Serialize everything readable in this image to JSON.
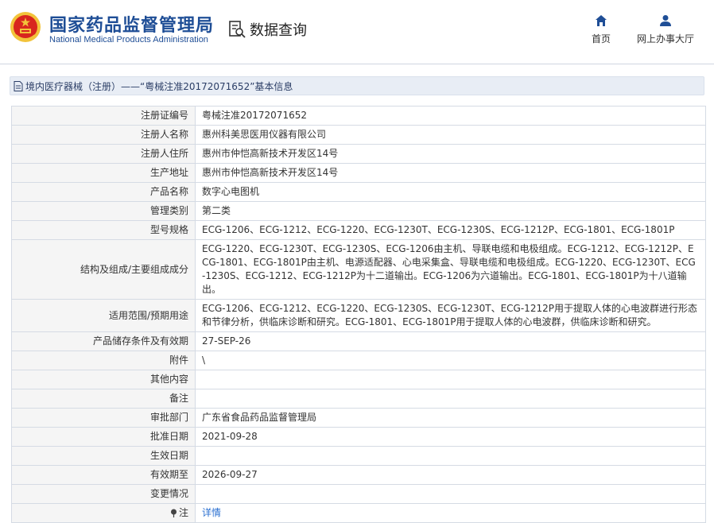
{
  "header": {
    "brand_cn": "国家药品监督管理局",
    "brand_en": "National Medical Products Administration",
    "query_label": "数据查询",
    "nav_home": "首页",
    "nav_hall": "网上办事大厅"
  },
  "breadcrumb": {
    "text": "境内医疗器械（注册）——“粤械注准20172071652”基本信息"
  },
  "rows": [
    {
      "label": "注册证编号",
      "value": "粤械注准20172071652"
    },
    {
      "label": "注册人名称",
      "value": "惠州科美思医用仪器有限公司"
    },
    {
      "label": "注册人住所",
      "value": "惠州市仲恺高新技术开发区14号"
    },
    {
      "label": "生产地址",
      "value": "惠州市仲恺高新技术开发区14号"
    },
    {
      "label": "产品名称",
      "value": "数字心电图机"
    },
    {
      "label": "管理类别",
      "value": "第二类"
    },
    {
      "label": "型号规格",
      "value": "ECG-1206、ECG-1212、ECG-1220、ECG-1230T、ECG-1230S、ECG-1212P、ECG-1801、ECG-1801P"
    },
    {
      "label": "结构及组成/主要组成成分",
      "value": "ECG-1220、ECG-1230T、ECG-1230S、ECG-1206由主机、导联电缆和电极组成。ECG-1212、ECG-1212P、ECG-1801、ECG-1801P由主机、电源适配器、心电采集盒、导联电缆和电极组成。ECG-1220、ECG-1230T、ECG-1230S、ECG-1212、ECG-1212P为十二道输出。ECG-1206为六道输出。ECG-1801、ECG-1801P为十八道输出。"
    },
    {
      "label": "适用范围/预期用途",
      "value": "ECG-1206、ECG-1212、ECG-1220、ECG-1230S、ECG-1230T、ECG-1212P用于提取人体的心电波群进行形态和节律分析，供临床诊断和研究。ECG-1801、ECG-1801P用于提取人体的心电波群，供临床诊断和研究。"
    },
    {
      "label": "产品储存条件及有效期",
      "value": "27-SEP-26"
    },
    {
      "label": "附件",
      "value": "\\"
    },
    {
      "label": "其他内容",
      "value": ""
    },
    {
      "label": "备注",
      "value": ""
    },
    {
      "label": "审批部门",
      "value": "广东省食品药品监督管理局"
    },
    {
      "label": "批准日期",
      "value": "2021-09-28"
    },
    {
      "label": "生效日期",
      "value": ""
    },
    {
      "label": "有效期至",
      "value": "2026-09-27"
    },
    {
      "label": "变更情况",
      "value": ""
    }
  ],
  "note_row": {
    "label": "注",
    "link": "详情"
  },
  "colors": {
    "brand_blue": "#1f4e96",
    "link_blue": "#2a6fd1",
    "emblem_red": "#d8261e",
    "emblem_gold": "#f2c33a"
  }
}
